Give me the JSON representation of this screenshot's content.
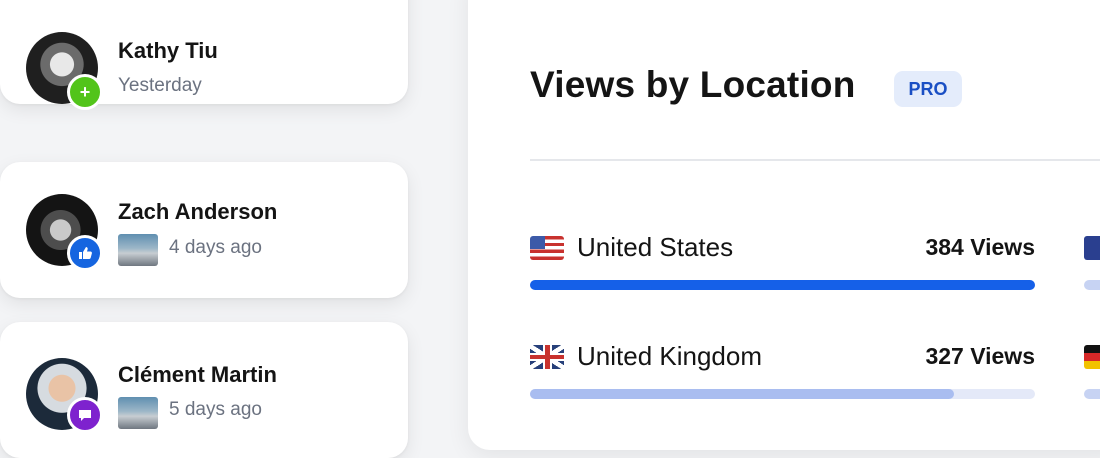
{
  "activity": [
    {
      "name": "Kathy Tiu",
      "time": "Yesterday",
      "badge_icon": "plus-icon",
      "badge_glyph": "+",
      "badge_color": "#52c41a"
    },
    {
      "name": "Zach Anderson",
      "time": "4 days ago",
      "badge_icon": "thumbs-up-icon",
      "badge_glyph": "👍",
      "badge_color": "#1565e0"
    },
    {
      "name": "Clément Martin",
      "time": "5 days ago",
      "badge_icon": "comment-icon",
      "badge_glyph": "▪",
      "badge_color": "#7e22ce"
    }
  ],
  "views_panel": {
    "title": "Views by Location",
    "badge": "PRO",
    "locations": [
      {
        "country": "United States",
        "flag_icon": "flag-us-icon",
        "views": "384 Views",
        "fraction": 1.0
      },
      {
        "country": "United Kingdom",
        "flag_icon": "flag-uk-icon",
        "views": "327 Views",
        "fraction": 0.84
      }
    ],
    "colors": {
      "bar_primary": "#1560e8",
      "bar_secondary": "#a9bdf0",
      "bar_track": "#e4e9f8",
      "pro_bg": "#e4ecfb",
      "pro_text": "#1a4fc4"
    }
  }
}
